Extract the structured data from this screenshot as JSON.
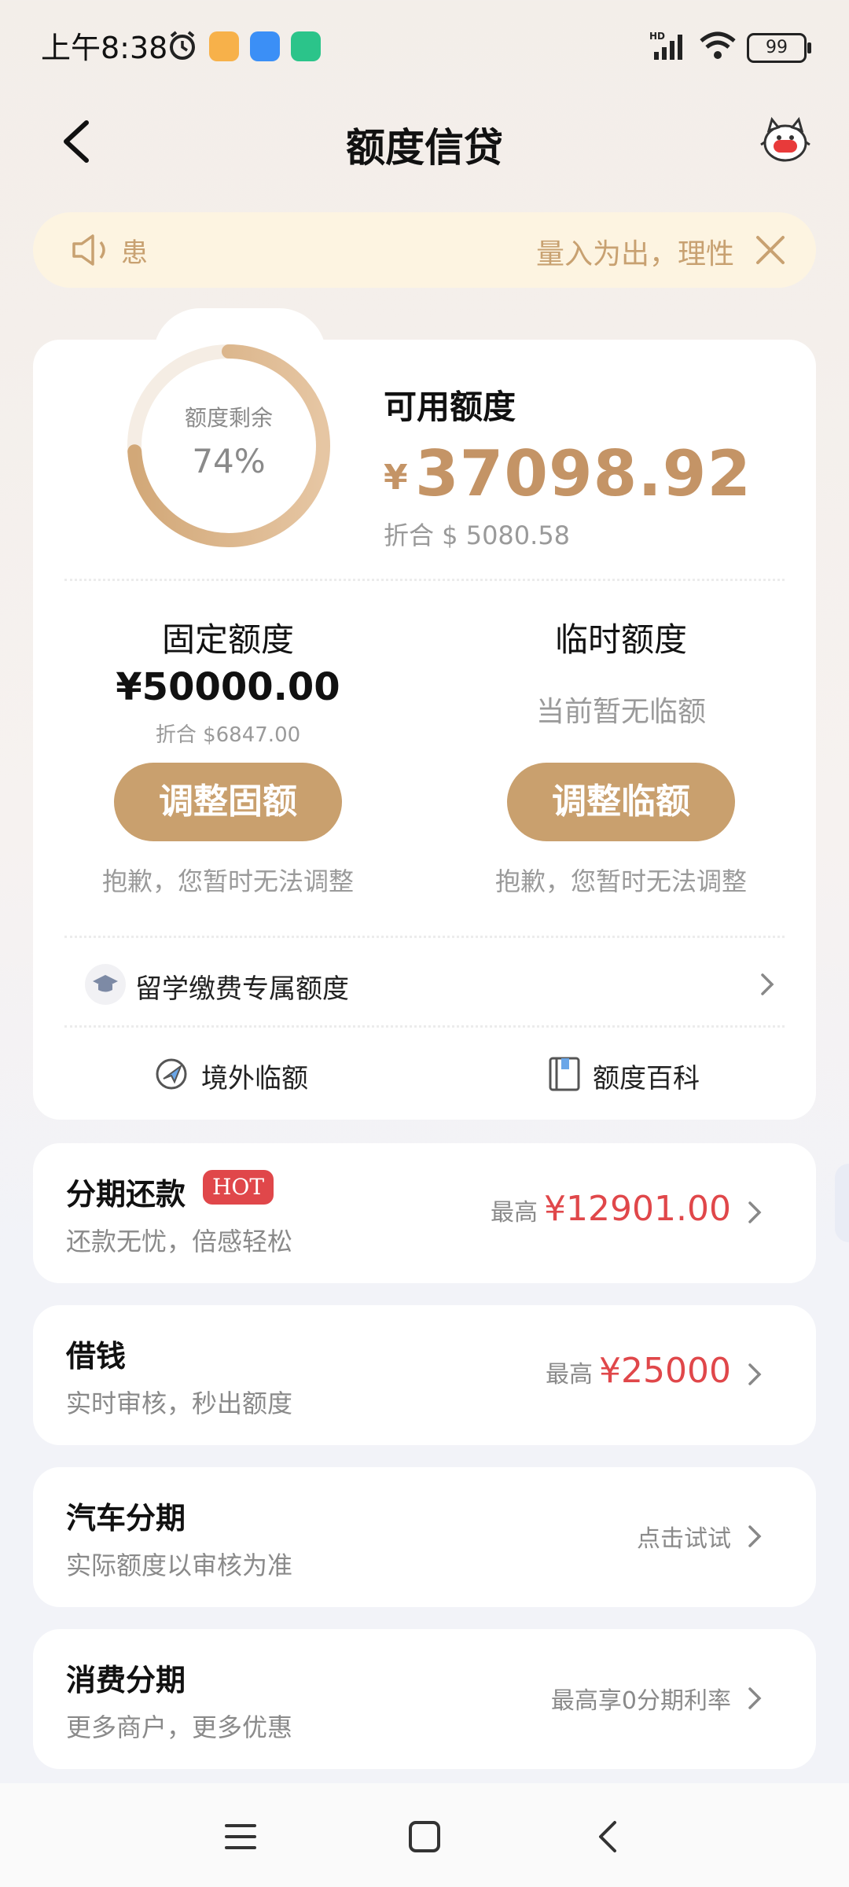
{
  "status_bar": {
    "time": "上午8:38",
    "battery": "99"
  },
  "header": {
    "title": "额度信贷"
  },
  "notice": {
    "prefix": "患",
    "text": "量入为出，理性"
  },
  "credit": {
    "ring_label": "额度剩余",
    "ring_percent_text": "74%",
    "remaining_fraction": 0.74,
    "available_title": "可用额度",
    "available_currency": "¥",
    "available_amount": "37098.92",
    "available_usd": "折合 $ 5080.58"
  },
  "fixed": {
    "title": "固定额度",
    "amount": "¥50000.00",
    "usd": "折合 $6847.00",
    "button": "调整固额",
    "note": "抱歉，您暂时无法调整"
  },
  "temporary": {
    "title": "临时额度",
    "status": "当前暂无临额",
    "button": "调整临额",
    "note": "抱歉，您暂时无法调整"
  },
  "study_abroad": {
    "label": "留学缴费专属额度"
  },
  "quick_links": [
    {
      "label": "境外临额",
      "icon": "plane-icon"
    },
    {
      "label": "额度百科",
      "icon": "book-icon"
    }
  ],
  "products": [
    {
      "title": "分期还款",
      "badge": "HOT",
      "subtitle": "还款无忧，倍感轻松",
      "right_label": "最高",
      "right_amount": "¥12901.00"
    },
    {
      "title": "借钱",
      "subtitle": "实时审核，秒出额度",
      "right_label": "最高",
      "right_amount": "¥25000"
    },
    {
      "title": "汽车分期",
      "subtitle": "实际额度以审核为准",
      "right_label": "点击试试"
    },
    {
      "title": "消费分期",
      "subtitle": "更多商户，更多优惠",
      "right_label": "最高享0分期利率"
    }
  ],
  "colors": {
    "accent": "#c9a06e",
    "gold_text": "#c49466",
    "red": "#e0474a"
  }
}
